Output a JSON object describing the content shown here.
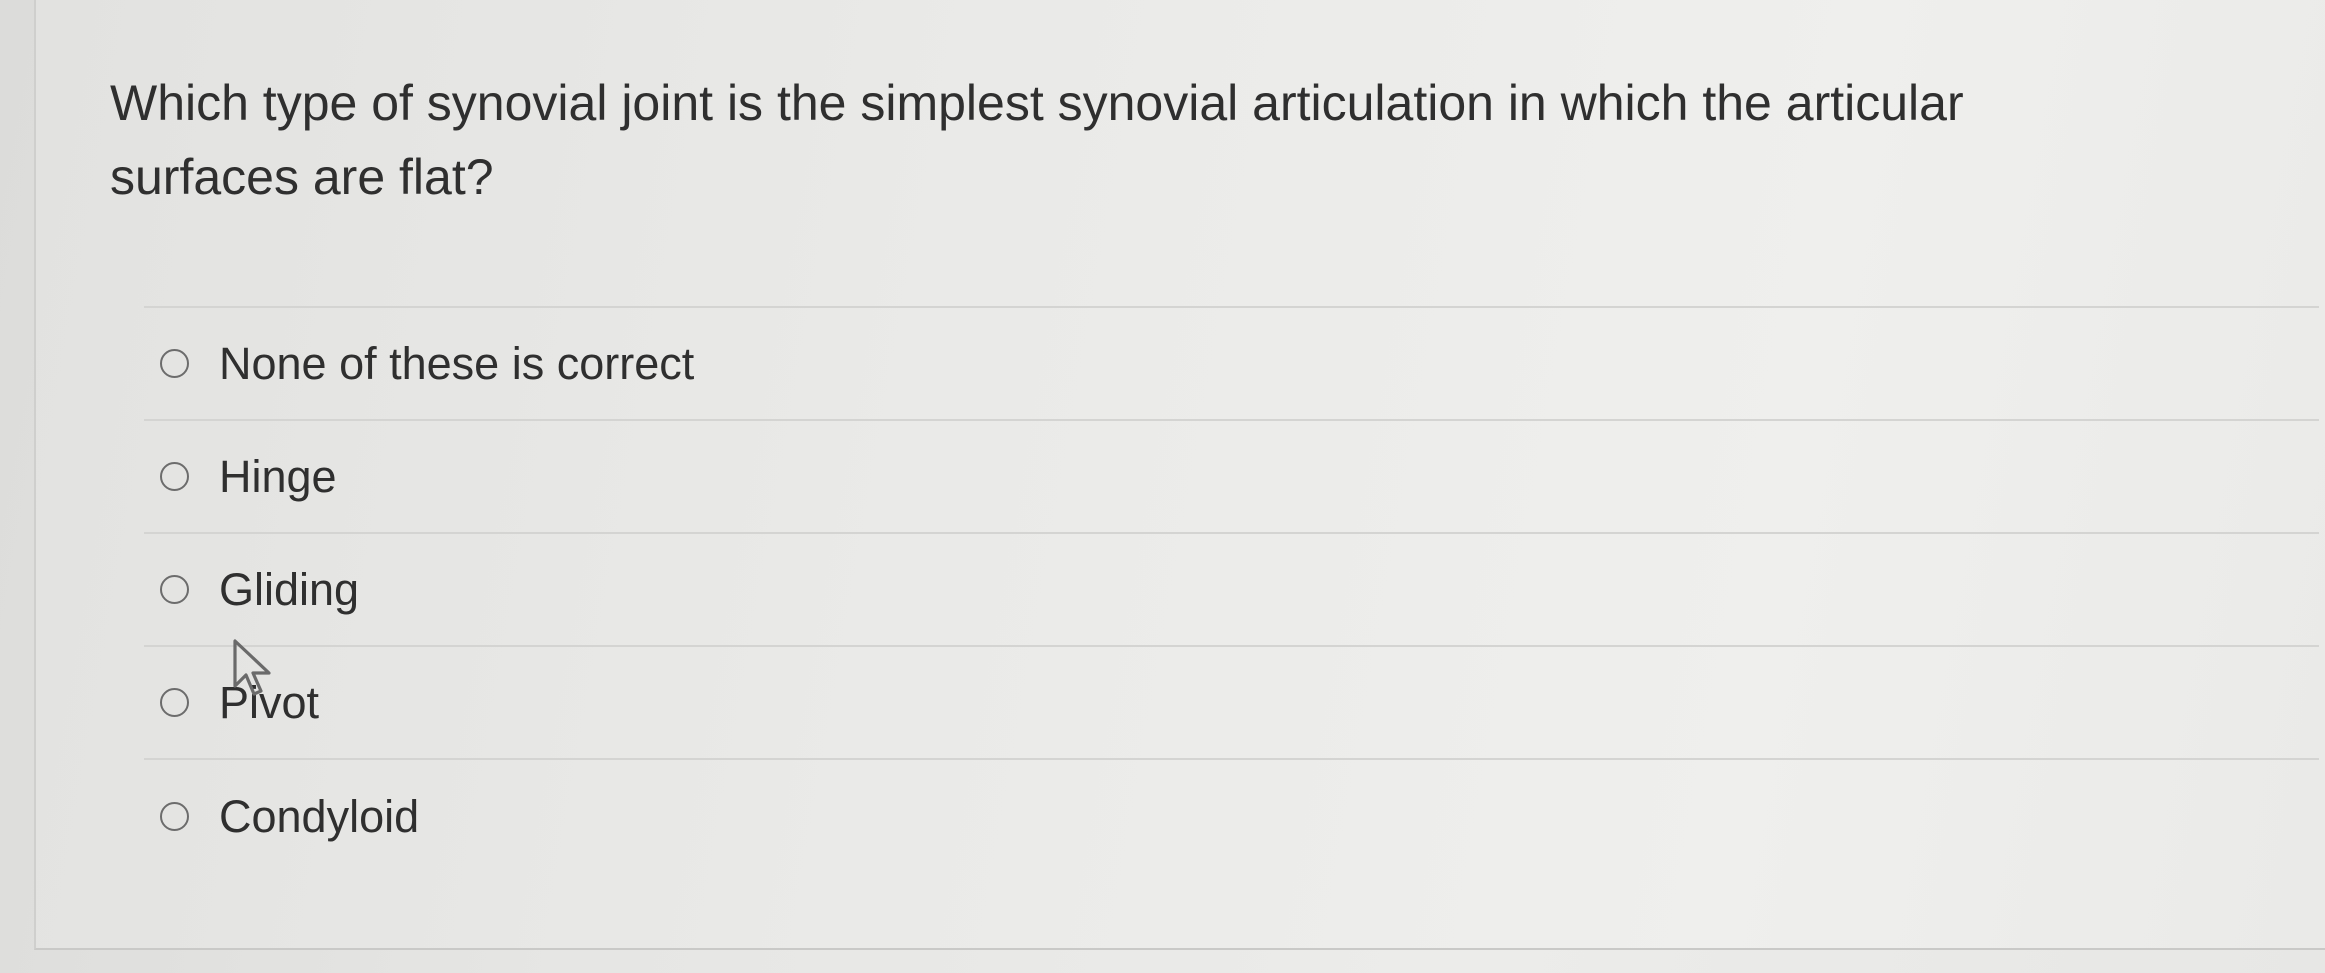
{
  "question": {
    "text": "Which type of synovial joint is the simplest synovial articulation in which the articular surfaces are flat?"
  },
  "options": [
    {
      "label": "None of these is correct",
      "selected": false
    },
    {
      "label": "Hinge",
      "selected": false
    },
    {
      "label": "Gliding",
      "selected": false
    },
    {
      "label": "Pivot",
      "selected": false
    },
    {
      "label": "Condyloid",
      "selected": false
    }
  ],
  "icons": {
    "radio": "radio-unchecked-icon",
    "cursor": "mouse-pointer-icon"
  }
}
